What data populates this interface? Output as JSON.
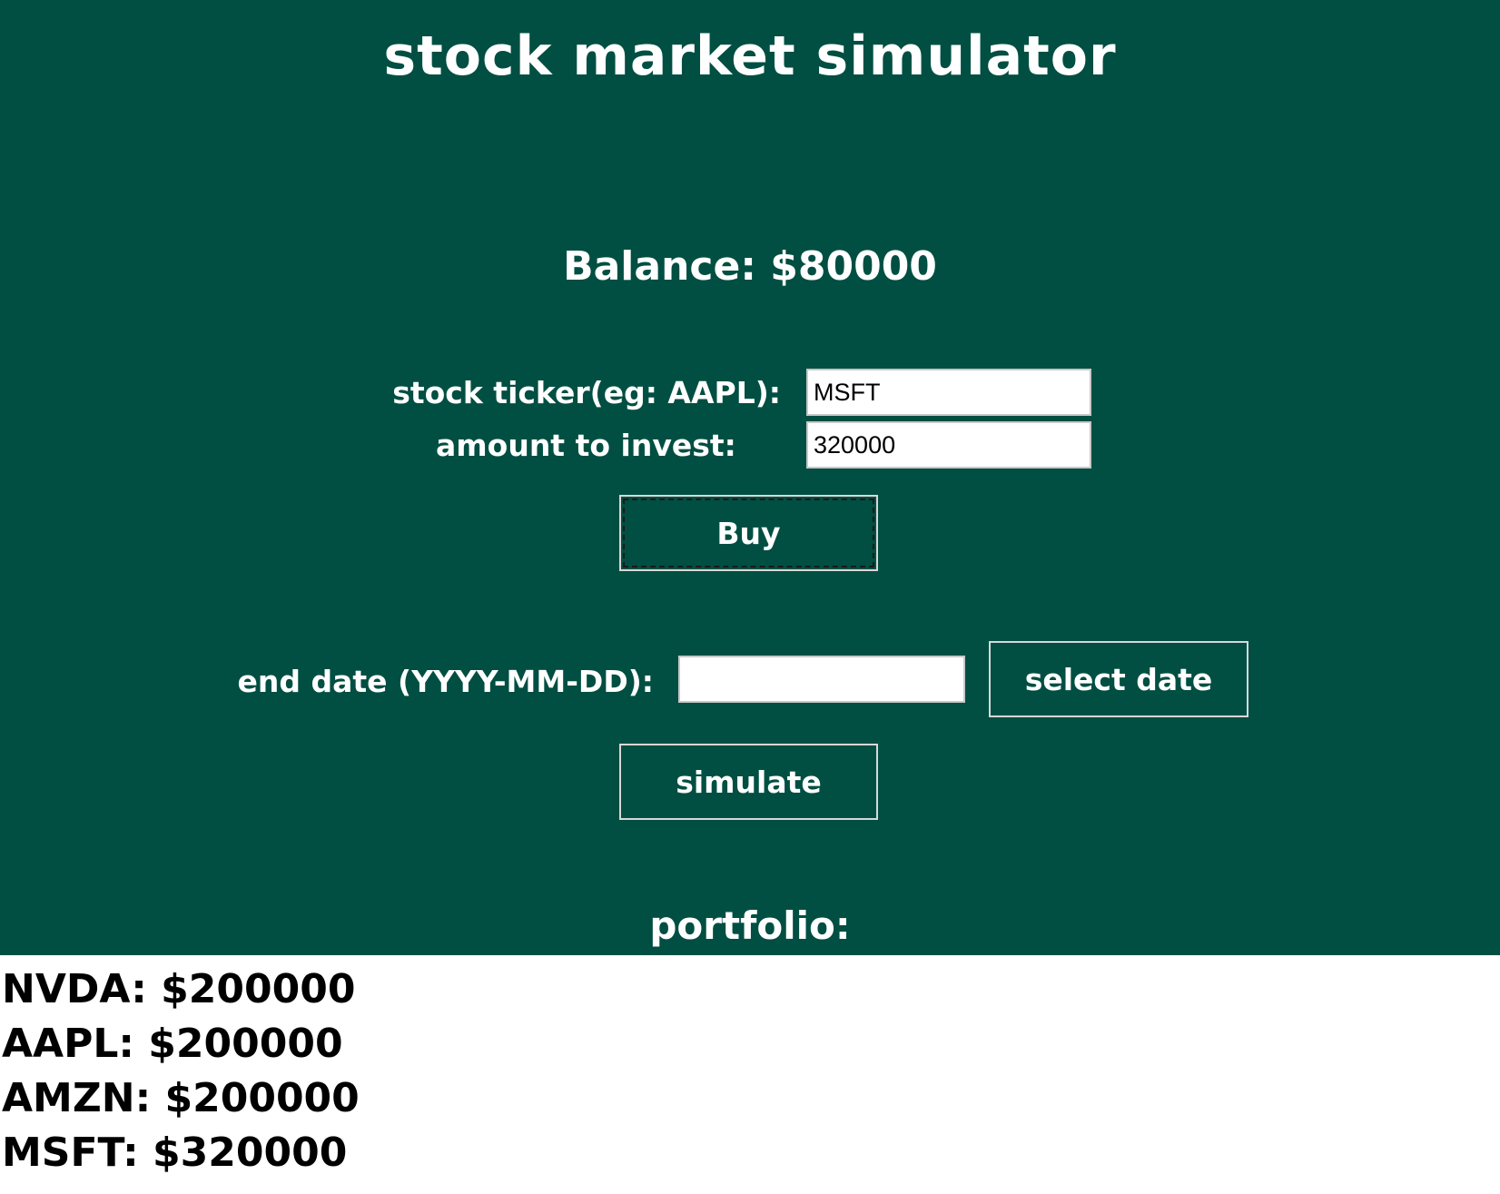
{
  "app": {
    "title": "stock market simulator",
    "balance": "Balance: $80000"
  },
  "form": {
    "ticker_label": "stock ticker(eg: AAPL):",
    "ticker_value": "MSFT",
    "amount_label": "amount to invest:",
    "amount_value": "320000",
    "buy_label": "Buy",
    "end_date_label": "end date (YYYY-MM-DD):",
    "end_date_value": "",
    "select_date_label": "select date",
    "simulate_label": "simulate"
  },
  "portfolio": {
    "title": "portfolio:",
    "items": [
      "NVDA: $200000",
      "AAPL: $200000",
      "AMZN: $200000",
      "MSFT: $320000"
    ]
  },
  "colors": {
    "panel_background": "#004f42",
    "text_on_panel": "#ffffff",
    "portfolio_background": "#ffffff"
  }
}
